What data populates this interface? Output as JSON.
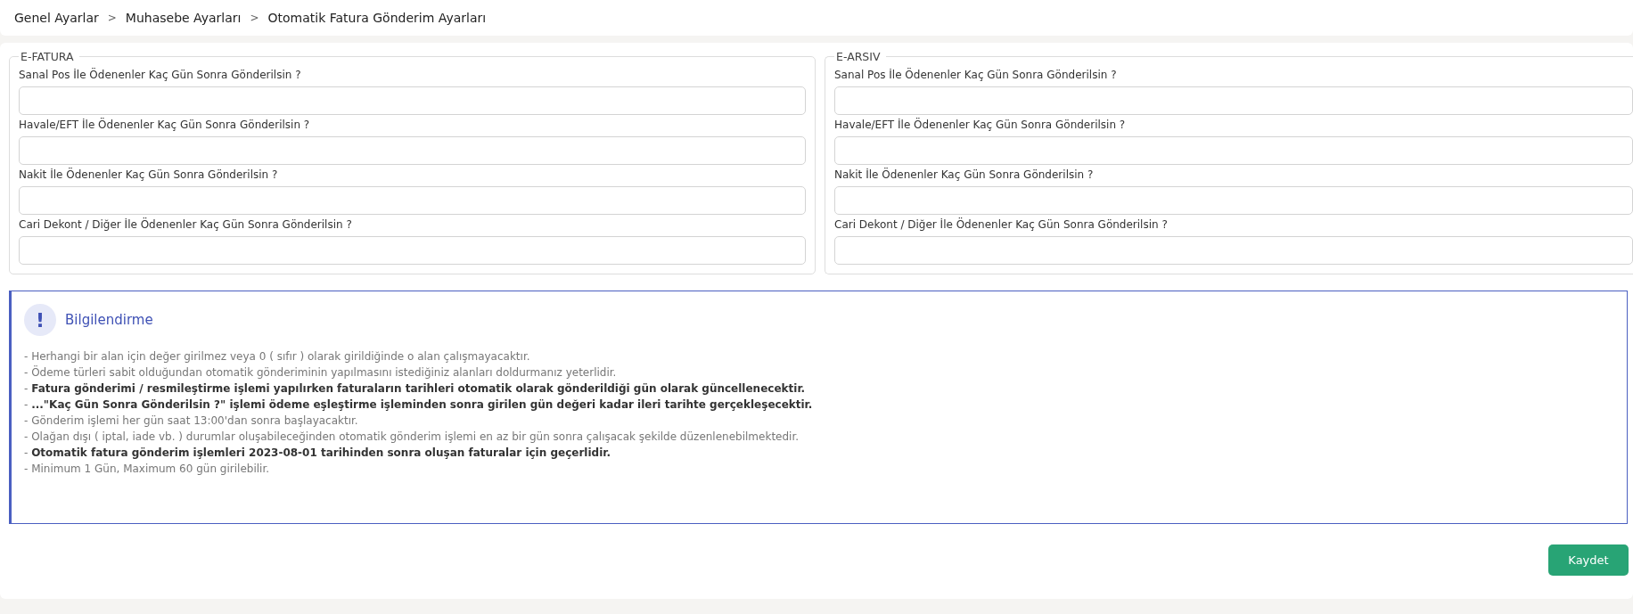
{
  "breadcrumb": [
    "Genel Ayarlar",
    "Muhasebe Ayarları",
    "Otomatik Fatura Gönderim Ayarları"
  ],
  "separator": ">",
  "sections": [
    {
      "legend": "E-FATURA",
      "fields": [
        {
          "label": "Sanal Pos İle Ödenenler Kaç Gün Sonra Gönderilsin ?"
        },
        {
          "label": "Havale/EFT İle Ödenenler Kaç Gün Sonra Gönderilsin ?"
        },
        {
          "label": "Nakit İle Ödenenler Kaç Gün Sonra Gönderilsin ?"
        },
        {
          "label": "Cari Dekont / Diğer İle Ödenenler Kaç Gün Sonra Gönderilsin ?"
        }
      ]
    },
    {
      "legend": "E-ARSIV",
      "fields": [
        {
          "label": "Sanal Pos İle Ödenenler Kaç Gün Sonra Gönderilsin ?"
        },
        {
          "label": "Havale/EFT İle Ödenenler Kaç Gün Sonra Gönderilsin ?"
        },
        {
          "label": "Nakit İle Ödenenler Kaç Gün Sonra Gönderilsin ?"
        },
        {
          "label": "Cari Dekont / Diğer İle Ödenenler Kaç Gün Sonra Gönderilsin ?"
        }
      ]
    }
  ],
  "info": {
    "icon": "!",
    "title": "Bilgilendirme",
    "lines": [
      "- Herhangi bir alan için değer girilmez veya 0 ( sıfır ) olarak girildiğinde o alan çalışmayacaktır.",
      "- Ödeme türleri sabit olduğundan otomatik gönderiminin yapılmasını istediğiniz alanları doldurmanız yeterlidir.",
      "- **Fatura gönderimi / resmileştirme işlemi yapılırken faturaların tarihleri otomatik olarak gönderildiği gün olarak güncellenecektir.**",
      "- **...\"Kaç Gün Sonra Gönderilsin ?\" işlemi ödeme eşleştirme işleminden sonra girilen gün değeri kadar ileri tarihte gerçekleşecektir.**",
      "- Gönderim işlemi her gün saat 13:00'dan sonra başlayacaktır.",
      "- Olağan dışı ( iptal, iade vb. ) durumlar oluşabileceğinden otomatik gönderim işlemi en az bir gün sonra çalışacak şekilde düzenlenebilmektedir.",
      "- **Otomatik fatura gönderim işlemleri 2023-08-01 tarihinden sonra oluşan faturalar için geçerlidir.**",
      "- Minimum 1 Gün, Maximum 60 gün girilebilir."
    ]
  },
  "save_button": "Kaydet"
}
